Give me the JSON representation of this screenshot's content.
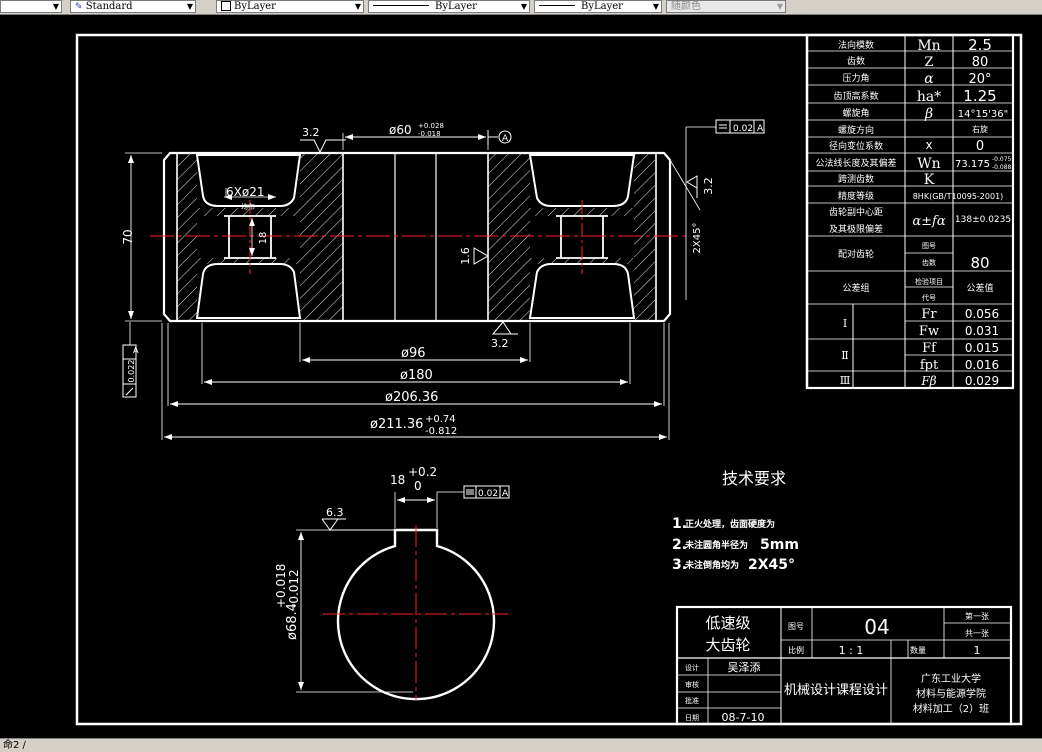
{
  "toolbar": {
    "textstyle_value": "Standard",
    "layer_value": "ByLayer",
    "linetype_value": "ByLayer",
    "lineweight_value": "ByLayer",
    "color_value": "随颜色"
  },
  "status": {
    "text": "命2 /"
  },
  "params": {
    "rows": [
      {
        "label": "法向模数",
        "symbol": "Mn",
        "value": "2.5"
      },
      {
        "label": "齿数",
        "symbol": "Z",
        "value": "80"
      },
      {
        "label": "压力角",
        "symbol": "α",
        "value": "20°"
      },
      {
        "label": "齿顶高系数",
        "symbol": "ha*",
        "value": "1.25"
      },
      {
        "label": "螺旋角",
        "symbol": "β",
        "value": "14°15'36\""
      },
      {
        "label": "螺旋方向",
        "symbol": "",
        "value": "右旋"
      },
      {
        "label": "径向变位系数",
        "symbol": "x",
        "value": "0"
      },
      {
        "label": "公法线长度及其偏差",
        "symbol": "Wn",
        "value": "73.175",
        "value_upper": "-0.075",
        "value_lower": "-0.088"
      },
      {
        "label": "跨测齿数",
        "symbol": "K",
        "value": ""
      },
      {
        "label": "精度等级",
        "symbol": "",
        "value": "8HK(GB/T10095-2001)"
      },
      {
        "label1": "齿轮副中心距",
        "label2": "及其极限偏差",
        "symbol": "α±fα",
        "value": "138±0.0235"
      },
      {
        "label": "配对齿轮",
        "sub1": "图号",
        "sub2": "齿数",
        "value2": "80"
      },
      {
        "label": "公差组",
        "sub1": "检验项目",
        "sub2": "代号",
        "value": "公差值"
      }
    ],
    "groups": [
      {
        "label": "Ⅰ",
        "items": [
          {
            "code": "Fr",
            "value": "0.056"
          },
          {
            "code": "Fw",
            "value": "0.031"
          }
        ]
      },
      {
        "label": "Ⅱ",
        "items": [
          {
            "code": "Ff",
            "value": "0.015"
          },
          {
            "code": "fpt",
            "value": "0.016"
          }
        ]
      },
      {
        "label": "Ⅲ",
        "items": [
          {
            "code": "Fβ",
            "value": "0.029"
          }
        ]
      }
    ]
  },
  "dims": {
    "top_bore": "ø60",
    "top_bore_up": "+0.028",
    "top_bore_lo": "-0.018",
    "datum_a": "A",
    "runout_tol": "0.02",
    "runout_datum": "A",
    "rough_top": "3.2",
    "rough_bottom": "3.2",
    "rough_right": "3.2",
    "rough_bore": "1.6",
    "holes": "6Xø21",
    "holes_sub": "均布",
    "web": "18",
    "height": "70",
    "chamfer": "2X45°",
    "side_tol": "0.022",
    "side_datum": "A",
    "d96": "ø96",
    "d180": "ø180",
    "d20636": "ø206.36",
    "d21136": "ø211.36",
    "d21136_up": "+0.74",
    "d21136_lo": "-0.812"
  },
  "keyway": {
    "width": "18",
    "width_up": "+0.2",
    "width_lo": "0",
    "sym_tol": "0.02",
    "sym_datum": "A",
    "rough": "6.3",
    "depth": "ø68.4",
    "depth_up": "+0.018",
    "depth_lo": "-0.012"
  },
  "tech": {
    "title": "技术要求",
    "item1_num": "1.",
    "item1": "正火处理，齿面硬度为",
    "item2_num": "2.",
    "item2": "未注圆角半径为",
    "item2_value": "5mm",
    "item3_num": "3.",
    "item3": "未注倒角均为",
    "item3_value": "2X45°"
  },
  "titleblock": {
    "name1": "低速级",
    "name2": "大齿轮",
    "drawing_no_label": "图号",
    "drawing_no": "04",
    "sheet1": "第一张",
    "sheet2": "共一张",
    "scale_label": "比例",
    "scale": "1 : 1",
    "qty_label": "数量",
    "qty": "1",
    "designer_label": "设计",
    "designer": "吴泽添",
    "checker_label": "审核",
    "approver_label": "批准",
    "date_label": "日期",
    "date": "08-7-10",
    "course": "机械设计课程设计",
    "school1": "广东工业大学",
    "school2": "材料与能源学院",
    "school3": "材料加工（2）班"
  }
}
